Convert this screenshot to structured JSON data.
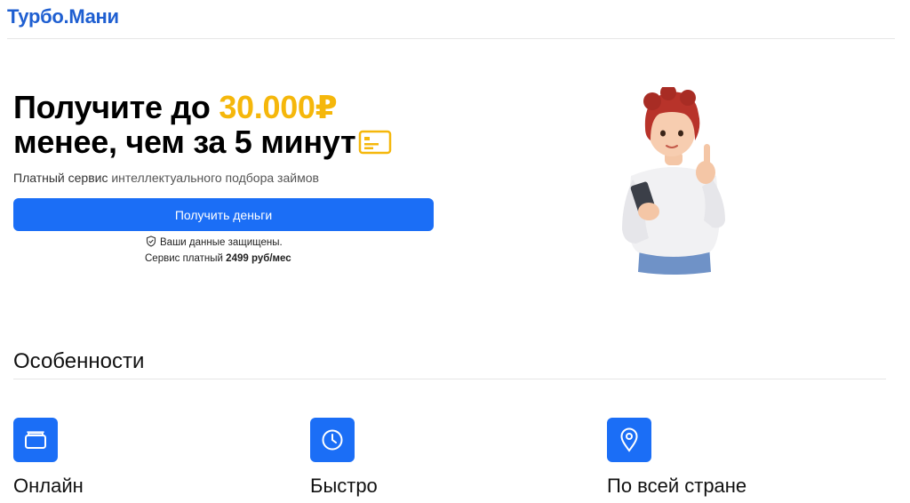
{
  "header": {
    "logo": "Турбо.Мани"
  },
  "hero": {
    "title_line1_prefix": "Получите до ",
    "title_amount": "30.000₽",
    "title_line2": "менее, чем за 5 минут",
    "subtitle_strong": "Платный сервис",
    "subtitle_rest": " интеллектуального подбора займов",
    "cta_label": "Получить деньги",
    "secure_text": "Ваши данные защищены.",
    "pricing_prefix": "Сервис платный ",
    "pricing_value": "2499 руб/мес"
  },
  "features": {
    "title": "Особенности",
    "items": [
      {
        "label": "Онлайн",
        "icon": "wallet-icon"
      },
      {
        "label": "Быстро",
        "icon": "clock-icon"
      },
      {
        "label": "По всей стране",
        "icon": "map-pin-icon"
      }
    ]
  },
  "colors": {
    "brand": "#1f5fd1",
    "accent": "#f5b70b",
    "button": "#1b6ef6"
  }
}
